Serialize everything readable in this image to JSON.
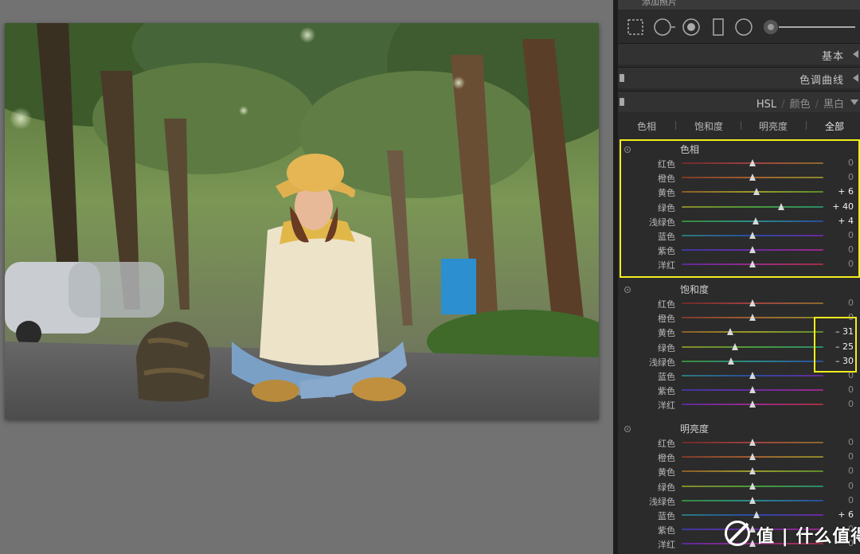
{
  "panel": {
    "top_partial_label": "添加照片",
    "sections": {
      "basic": "基本",
      "tone_curve": "色调曲线"
    },
    "hsl_header": {
      "hsl": "HSL",
      "color": "颜色",
      "bw": "黑白",
      "sep": "/"
    },
    "subtabs": [
      "色相",
      "饱和度",
      "明亮度",
      "全部"
    ],
    "active_subtab": "全部",
    "groups": [
      {
        "title": "色相",
        "rows": [
          {
            "label": "红色",
            "value": "0",
            "level": 0
          },
          {
            "label": "橙色",
            "value": "0",
            "level": 0
          },
          {
            "label": "黄色",
            "value": "+ 6",
            "level": 6
          },
          {
            "label": "绿色",
            "value": "+ 40",
            "level": 40
          },
          {
            "label": "浅绿色",
            "value": "+ 4",
            "level": 4
          },
          {
            "label": "蓝色",
            "value": "0",
            "level": 0
          },
          {
            "label": "紫色",
            "value": "0",
            "level": 0
          },
          {
            "label": "洋红",
            "value": "0",
            "level": 0
          }
        ]
      },
      {
        "title": "饱和度",
        "rows": [
          {
            "label": "红色",
            "value": "0",
            "level": 0
          },
          {
            "label": "橙色",
            "value": "0",
            "level": 0
          },
          {
            "label": "黄色",
            "value": "– 31",
            "level": -31
          },
          {
            "label": "绿色",
            "value": "– 25",
            "level": -25
          },
          {
            "label": "浅绿色",
            "value": "– 30",
            "level": -30
          },
          {
            "label": "蓝色",
            "value": "0",
            "level": 0
          },
          {
            "label": "紫色",
            "value": "0",
            "level": 0
          },
          {
            "label": "洋红",
            "value": "0",
            "level": 0
          }
        ]
      },
      {
        "title": "明亮度",
        "rows": [
          {
            "label": "红色",
            "value": "0",
            "level": 0
          },
          {
            "label": "橙色",
            "value": "0",
            "level": 0
          },
          {
            "label": "黄色",
            "value": "0",
            "level": 0
          },
          {
            "label": "绿色",
            "value": "0",
            "level": 0
          },
          {
            "label": "浅绿色",
            "value": "0",
            "level": 0
          },
          {
            "label": "蓝色",
            "value": "+ 6",
            "level": 6
          },
          {
            "label": "紫色",
            "value": "0",
            "level": 0
          },
          {
            "label": "洋红",
            "value": "0",
            "level": 0
          }
        ]
      }
    ],
    "track_colors": {
      "红色": [
        "#6b2a2a",
        "#a04040",
        "#8a6a2a"
      ],
      "橙色": [
        "#7a3a2a",
        "#a06030",
        "#8a8a2a"
      ],
      "黄色": [
        "#8a5a2a",
        "#9a9a2a",
        "#5a8a2a"
      ],
      "绿色": [
        "#8a8a2a",
        "#4a9a3a",
        "#2a8a6a"
      ],
      "浅绿色": [
        "#3a8a3a",
        "#2a8a8a",
        "#2a4a9a"
      ],
      "蓝色": [
        "#2a7a7a",
        "#2a4aa0",
        "#6a2a9a"
      ],
      "紫色": [
        "#3a3a9a",
        "#6a2aa0",
        "#9a2a8a"
      ],
      "洋红": [
        "#5a2a9a",
        "#9a2a8a",
        "#a03040"
      ]
    },
    "highlight_color": "#f2ef1c"
  },
  "watermark": {
    "text": "值 | 什么值得买",
    "icon": "zhi-logo-icon"
  }
}
